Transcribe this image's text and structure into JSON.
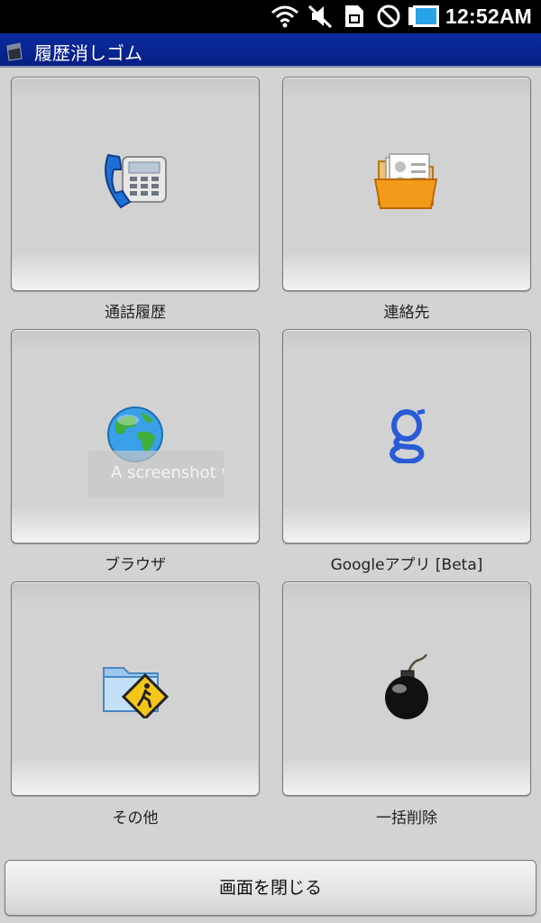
{
  "status_bar": {
    "time": "12:52AM",
    "icons": [
      "wifi-icon",
      "muted-speaker-icon",
      "sim-card-icon",
      "no-sign-icon",
      "battery-icon"
    ]
  },
  "title_bar": {
    "title": "履歴消しゴム",
    "icon": "eraser-app-icon"
  },
  "tiles": [
    {
      "label": "通話履歴",
      "icon": "phone-icon"
    },
    {
      "label": "連絡先",
      "icon": "contacts-folder-icon"
    },
    {
      "label": "ブラウザ",
      "icon": "globe-icon"
    },
    {
      "label": "Googleアプリ [Beta]",
      "icon": "google-g-icon"
    },
    {
      "label": "その他",
      "icon": "folder-pedestrian-icon"
    },
    {
      "label": "一括削除",
      "icon": "bomb-icon"
    }
  ],
  "toast": {
    "text": "A screenshot was saved"
  },
  "close_button": {
    "label": "画面を閉じる"
  },
  "colors": {
    "title_bar": "#0a2a9e",
    "background": "#d3d3d3",
    "status_bar": "#000000"
  }
}
